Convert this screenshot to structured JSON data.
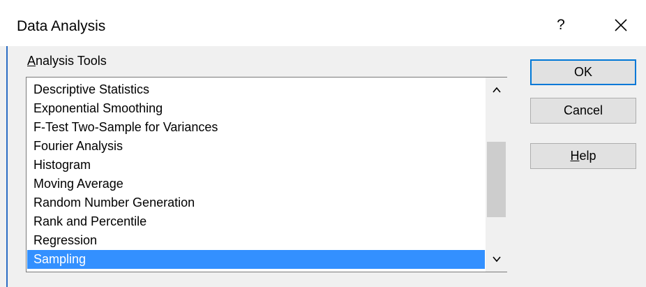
{
  "window": {
    "title": "Data Analysis",
    "help_glyph": "?",
    "close_icon": "close-icon"
  },
  "analysis_tools": {
    "label": "Analysis Tools",
    "label_access_key": "A",
    "items": [
      {
        "label": "Descriptive Statistics"
      },
      {
        "label": "Exponential Smoothing"
      },
      {
        "label": "F-Test Two-Sample for Variances"
      },
      {
        "label": "Fourier Analysis"
      },
      {
        "label": "Histogram"
      },
      {
        "label": "Moving Average"
      },
      {
        "label": "Random Number Generation"
      },
      {
        "label": "Rank and Percentile"
      },
      {
        "label": "Regression"
      },
      {
        "label": "Sampling"
      }
    ],
    "selected_index": 9,
    "scrollbar": {
      "up_icon": "chevron-up-icon",
      "down_icon": "chevron-down-icon"
    }
  },
  "buttons": {
    "ok_label": "OK",
    "cancel_label": "Cancel",
    "help_label": "Help",
    "help_access_key": "H"
  },
  "colors": {
    "selection": "#3390ff",
    "accent": "#0078d7",
    "dialog_bg": "#f0f0f0"
  }
}
